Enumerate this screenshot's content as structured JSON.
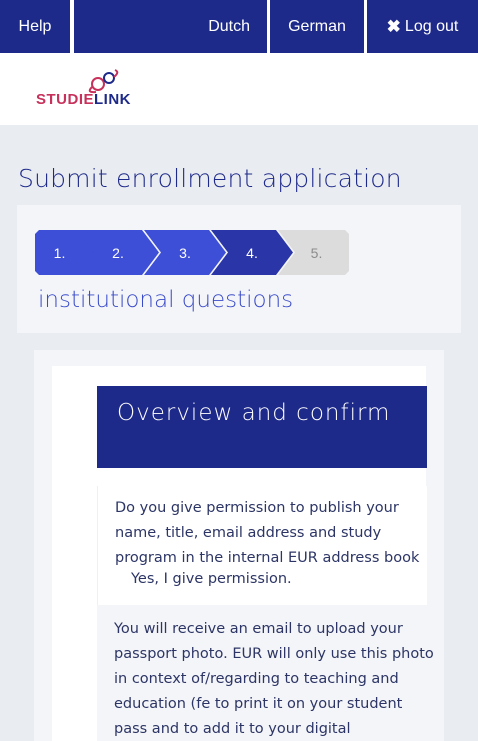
{
  "topbar": {
    "help": "Help",
    "dutch": "Dutch",
    "german": "German",
    "logout": "Log out"
  },
  "logo": {
    "part1": "STUDIE",
    "part2": "LINK"
  },
  "page_title": "Submit enrollment application",
  "steps": {
    "items": [
      "1.",
      "2.",
      "3.",
      "4.",
      "5."
    ],
    "current_label": "institutional questions"
  },
  "section_title": "Overview and confirm",
  "permission": {
    "question": "Do you give permission to publish your name, title, email address and study program in the internal EUR address book",
    "answer": "Yes, I give permission."
  },
  "photo_info": "You will receive an email to upload your passport photo. EUR will only use this photo in context of/regarding to teaching and education (fe to print it on your student pass and to add it to your digital",
  "colors": {
    "navy": "#1e2a8a",
    "step_done": "#3d4fd6",
    "step_current": "#2a36a8",
    "step_todo": "#dcdcdc",
    "logo_pink": "#c7315b"
  }
}
